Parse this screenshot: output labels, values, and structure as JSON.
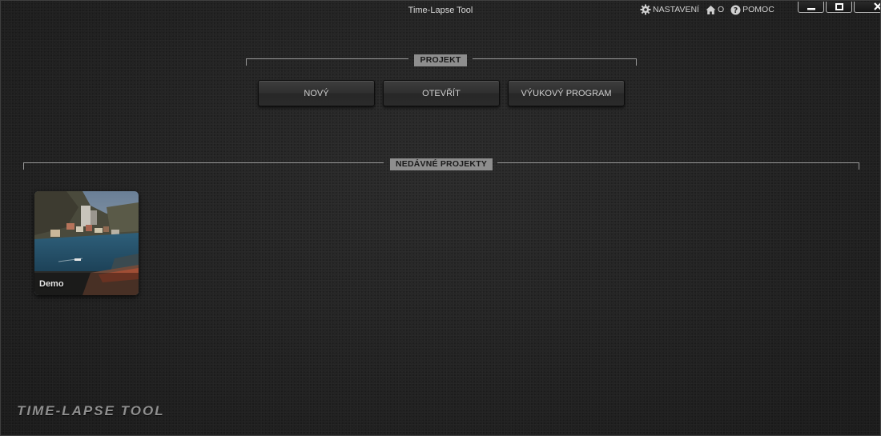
{
  "window": {
    "title": "Time-Lapse Tool"
  },
  "top_menu": {
    "settings_label": "NASTAVENÍ",
    "about_label": "O",
    "help_label": "POMOC"
  },
  "window_controls": {
    "minimize_icon": "minimize-icon",
    "maximize_icon": "maximize-icon",
    "close_icon": "close-icon"
  },
  "project_section": {
    "header": "PROJEKT",
    "buttons": {
      "new": "NOVÝ",
      "open": "OTEVŘÍT",
      "tutorial": "VÝUKOVÝ PROGRAM"
    }
  },
  "recent_section": {
    "header": "NEDÁVNÉ PROJEKTY",
    "projects": [
      {
        "name": "Demo",
        "thumbnail": "harbor-town-photo"
      }
    ]
  },
  "branding": {
    "logo_text": "TIME-LAPSE TOOL"
  },
  "colors": {
    "background": "#232323",
    "section_label_bg": "#8e8e8e",
    "button_bg": "#2f2f2f",
    "text": "#cfcfcf"
  }
}
